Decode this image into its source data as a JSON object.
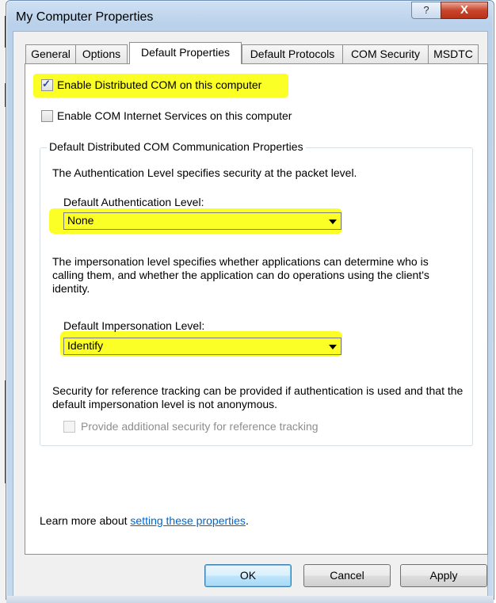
{
  "window": {
    "title": "My Computer Properties",
    "help_glyph": "?",
    "close_glyph": "X"
  },
  "tabs": [
    {
      "label": "General",
      "active": false
    },
    {
      "label": "Options",
      "active": false
    },
    {
      "label": "Default Properties",
      "active": true
    },
    {
      "label": "Default Protocols",
      "active": false
    },
    {
      "label": "COM Security",
      "active": false
    },
    {
      "label": "MSDTC",
      "active": false
    }
  ],
  "options": {
    "enable_dcom": {
      "label": "Enable Distributed COM on this computer",
      "checked": true
    },
    "enable_com_internet": {
      "label": "Enable COM Internet Services on this computer",
      "checked": false
    }
  },
  "group": {
    "title": "Default Distributed COM Communication Properties",
    "auth_description": "The Authentication Level specifies security at the packet level.",
    "auth_label": "Default Authentication Level:",
    "auth_value": "None",
    "imp_description": "The impersonation level specifies whether applications can determine who is calling them, and whether the application can do operations using the client's identity.",
    "imp_label": "Default Impersonation Level:",
    "imp_value": "Identify",
    "tracking_description": "Security for reference tracking can be provided if authentication is used and that the default impersonation level is not anonymous.",
    "tracking_checkbox": {
      "label": "Provide additional security for reference tracking",
      "checked": false,
      "disabled": true
    }
  },
  "learn_more": {
    "prefix": "Learn more about ",
    "link": "setting these properties",
    "suffix": "."
  },
  "buttons": {
    "ok": "OK",
    "cancel": "Cancel",
    "apply": "Apply"
  },
  "colors": {
    "highlight": "#fbff00",
    "link": "#0066cc",
    "close_button": "#c9462c"
  }
}
